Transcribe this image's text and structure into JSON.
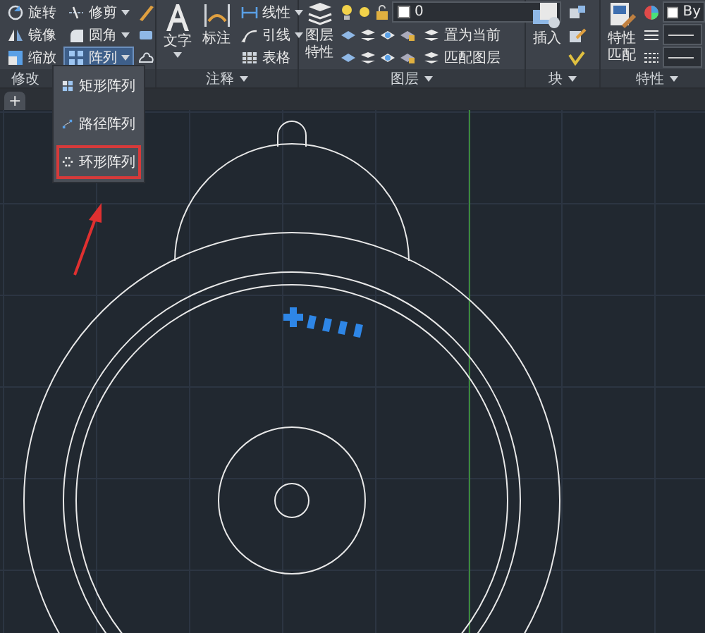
{
  "ribbon": {
    "modify": {
      "title": "修改",
      "tools": [
        {
          "label": "旋转",
          "dropdown": false,
          "active": false
        },
        {
          "label": "修剪",
          "dropdown": true,
          "active": false
        },
        {
          "label": "镜像",
          "dropdown": false,
          "active": false
        },
        {
          "label": "圆角",
          "dropdown": true,
          "active": false
        },
        {
          "label": "缩放",
          "dropdown": false,
          "active": false
        },
        {
          "label": "阵列",
          "dropdown": true,
          "active": true
        }
      ]
    },
    "annotation": {
      "title": "注释",
      "menu": true,
      "large": [
        {
          "label": "文字",
          "dropdown": true
        },
        {
          "label": "标注",
          "dropdown": false
        }
      ],
      "tools": [
        {
          "label": "线性",
          "dropdown": true
        },
        {
          "label": "引线",
          "dropdown": true
        },
        {
          "label": "表格",
          "dropdown": false
        }
      ]
    },
    "layers": {
      "title": "图层",
      "menu": true,
      "large": {
        "label": "图层特性"
      },
      "layer": {
        "value": "0"
      },
      "tools": [
        {
          "label": "置为当前"
        },
        {
          "label": "匹配图层"
        }
      ]
    },
    "block": {
      "title": "块",
      "menu": true,
      "large": {
        "label": "插入"
      }
    },
    "properties": {
      "title": "特性",
      "menu": true,
      "large": {
        "label": "特性匹配"
      },
      "color": {
        "value": "By"
      }
    }
  },
  "file_tabs": [
    {
      "label": "+"
    }
  ],
  "array_menu": [
    {
      "label": "矩形阵列",
      "selected": false
    },
    {
      "label": "路径阵列",
      "selected": false
    },
    {
      "label": "环形阵列",
      "selected": true
    }
  ]
}
